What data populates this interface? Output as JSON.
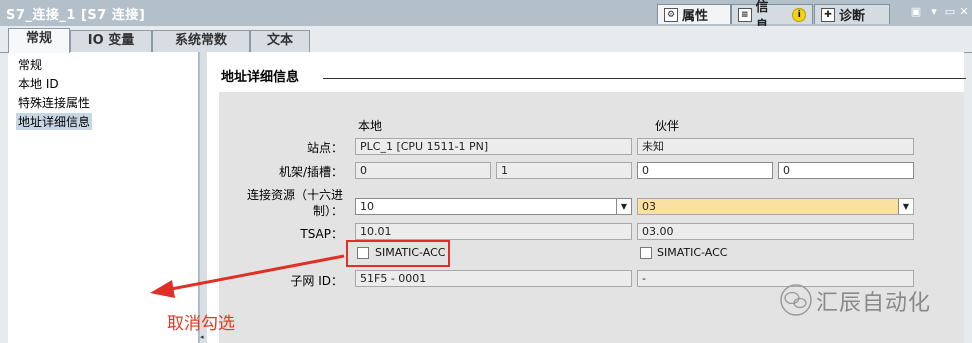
{
  "window": {
    "title": "S7_连接_1 [S7 连接]"
  },
  "inspector_tabs": [
    {
      "label": "属性",
      "icon": "properties-icon",
      "active": true
    },
    {
      "label": "信息",
      "icon": "info-list-icon",
      "badge_icon": "info-badge-icon"
    },
    {
      "label": "诊断",
      "icon": "diagnostics-icon"
    }
  ],
  "tabs": [
    {
      "label": "常规",
      "active": true
    },
    {
      "label": "IO 变量"
    },
    {
      "label": "系统常数"
    },
    {
      "label": "文本"
    }
  ],
  "sidebar": {
    "items": [
      {
        "label": "常规"
      },
      {
        "label": "本地 ID"
      },
      {
        "label": "特殊连接属性"
      },
      {
        "label": "地址详细信息",
        "active": true
      }
    ]
  },
  "section": {
    "title": "地址详细信息",
    "local_header": "本地",
    "partner_header": "伙伴",
    "rows": {
      "station": {
        "label": "站点：",
        "local": "PLC_1 [CPU 1511-1 PN]",
        "partner": "未知"
      },
      "rack_slot": {
        "label": "机架/插槽：",
        "local_rack": "0",
        "local_slot": "1",
        "partner_rack": "0",
        "partner_slot": "0"
      },
      "resource": {
        "label_line1": "连接资源（十六进",
        "label_line2": "制）：",
        "local": "10",
        "partner": "03"
      },
      "tsap": {
        "label": "TSAP：",
        "local": "10.01",
        "partner": "03.00"
      },
      "simatic_acc": {
        "local_label": "SIMATIC-ACC",
        "local_checked": false,
        "partner_label": "SIMATIC-ACC",
        "partner_checked": false
      },
      "subnet": {
        "label": "子网 ID：",
        "local": "51F5 - 0001",
        "partner": "-"
      }
    }
  },
  "annotation": {
    "text": "取消勾选",
    "color": "#e03a24"
  },
  "watermark": {
    "text": "汇辰自动化"
  },
  "colors": {
    "highlight_field": "#fbe1a1",
    "title_bar": "#b3c0ca",
    "annotation_red": "#e03025"
  }
}
